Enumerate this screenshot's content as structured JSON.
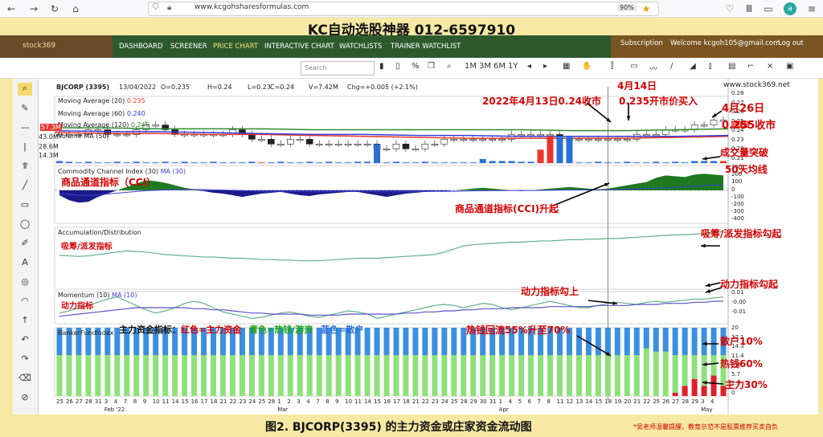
{
  "browser": {
    "url": "www.kcgohsharesformulas.com",
    "zoom": "90%"
  },
  "banner": {
    "title": "KC自动选股神器 012-6597910"
  },
  "site": {
    "logo": "stock369",
    "nav": [
      "DASHBOARD",
      "SCREENER",
      "PRICE CHART",
      "INTERACTIVE CHART",
      "WATCHLISTS",
      "TRAINER WATCHLIST"
    ],
    "subscription": "Subscription",
    "welcome": "Welcome kcgoh105@gmail.com",
    "logout": "Log out"
  },
  "toolbar": {
    "search_placeholder": "Search",
    "periods": [
      "1M",
      "3M",
      "6M",
      "1Y"
    ],
    "watermark": "www.stock369.net"
  },
  "chart_header": {
    "symbol": "BJCORP (3395)",
    "date": "13/04/2022",
    "open": "O=0.235",
    "high": "H=0.24",
    "low": "L=0.23",
    "close": "C=0.24",
    "volume": "V=7.42M",
    "change": "Chg=+0.005 (+2.1%)"
  },
  "legends": {
    "ma20": "Moving Average (20)",
    "ma20_val": "0.235",
    "ma60": "Moving Average (60)",
    "ma60_val": "0.240",
    "ma120": "Moving Average (120)",
    "ma120_val": "0.246",
    "vol": "Volume MA (50)",
    "cci": "Commodity Channel Index (30)",
    "cci_ma": "MA (30)",
    "ad": "Accumulation/Distribution",
    "mom": "Momentum (10)",
    "mom_ma": "MA (10)",
    "bfi": "BankerFundIndex"
  },
  "vol_levels": [
    "57.3M",
    "43.0M",
    "28.6M",
    "14.3M"
  ],
  "price_axis": [
    "0.28",
    "0.27",
    "0.26",
    "0.25",
    "0.24",
    "0.23",
    "0.22",
    "0.21"
  ],
  "price_current": "0.236",
  "cci_axis": [
    "300",
    "200",
    "100",
    "0",
    "-100",
    "-200",
    "-300",
    "-400"
  ],
  "mom_axis": [
    "0.01",
    "-0.00",
    "-0.01"
  ],
  "bfi_axis": [
    "20",
    "17.1",
    "14.3",
    "11.4",
    "8.6",
    "5.7",
    "2.9",
    "0"
  ],
  "date_labels": [
    "25",
    "26",
    "27",
    "28",
    "31",
    "3",
    "4",
    "7",
    "8",
    "9",
    "10",
    "11",
    "14",
    "15",
    "16",
    "17",
    "18",
    "21",
    "22",
    "23",
    "24",
    "25",
    "28",
    "1",
    "2",
    "3",
    "4",
    "7",
    "8",
    "9",
    "10",
    "11",
    "14",
    "15",
    "16",
    "17",
    "18",
    "21",
    "22",
    "23",
    "24",
    "25",
    "28",
    "29",
    "30",
    "31",
    "1",
    "4",
    "5",
    "6",
    "7",
    "8",
    "11",
    "12",
    "13",
    "14",
    "15",
    "18",
    "19",
    "20",
    "21",
    "22",
    "25",
    "26",
    "27",
    "28",
    "29",
    "3",
    "4"
  ],
  "month_labels": {
    "feb": "Feb '22",
    "mar": "Mar",
    "apr": "Apr",
    "may": "May"
  },
  "annotations": {
    "a1": "2022年4月13日0.24收市",
    "a2": "4月14日",
    "a3": "0.235开市价买入",
    "a4": "4月26日",
    "a5": "0.255收市",
    "a6": "成交量突破",
    "a7": "50天均线",
    "a8": "商品通道指标（CCI）",
    "a9": "商品通道指标(CCI)升起",
    "a10": "吸筹/派发指标",
    "a11": "吸筹/派发指标勾起",
    "a12": "动力指标",
    "a13": "动力指标勾上",
    "a14": "动力指标勾起",
    "a15": "主力资金指标：",
    "a15r": "红色=主力资金",
    "a15g": "青色=热钱/游资",
    "a15b": "蓝色=散户",
    "a16": "热钱回流55%升至70%",
    "a17": "散户10%",
    "a18": "热钱60%",
    "a19": "主力30%"
  },
  "footer": {
    "title": "图2. BJCORP(3395) 的主力资金或庄家资金流动图",
    "note": "*吴老师温馨提醒，教育示范不是股票推荐买卖自负"
  },
  "chart_data": {
    "type": "line",
    "ma_series": [
      {
        "name": "Moving Average (20)",
        "color": "#e8362c"
      },
      {
        "name": "Moving Average (60)",
        "color": "#3a3ad8"
      },
      {
        "name": "Moving Average (120)",
        "color": "#2e8b2e"
      }
    ],
    "price_ylim": [
      0.21,
      0.28
    ],
    "price_ma_values": {
      "ma20": [
        0.242,
        0.241,
        0.241,
        0.24,
        0.24,
        0.239,
        0.238,
        0.237,
        0.236,
        0.236,
        0.236,
        0.236,
        0.237,
        0.238
      ],
      "ma60": [
        0.244,
        0.243,
        0.243,
        0.242,
        0.241,
        0.24,
        0.24,
        0.239,
        0.239,
        0.238,
        0.238,
        0.238,
        0.238,
        0.239
      ],
      "ma120": [
        0.247,
        0.247,
        0.246,
        0.246,
        0.246,
        0.245,
        0.245,
        0.245,
        0.245,
        0.245,
        0.244,
        0.244,
        0.245,
        0.246
      ]
    },
    "closes": [
      0.24,
      0.24,
      0.24,
      0.245,
      0.245,
      0.24,
      0.24,
      0.24,
      0.245,
      0.25,
      0.25,
      0.245,
      0.24,
      0.24,
      0.24,
      0.24,
      0.24,
      0.24,
      0.245,
      0.24,
      0.235,
      0.235,
      0.23,
      0.23,
      0.235,
      0.235,
      0.23,
      0.23,
      0.23,
      0.23,
      0.23,
      0.23,
      0.23,
      0.225,
      0.225,
      0.23,
      0.225,
      0.225,
      0.23,
      0.23,
      0.235,
      0.235,
      0.235,
      0.235,
      0.235,
      0.235,
      0.235,
      0.24,
      0.24,
      0.24,
      0.24,
      0.24,
      0.235,
      0.235,
      0.235,
      0.235,
      0.235,
      0.235,
      0.235,
      0.235,
      0.24,
      0.24,
      0.24,
      0.245,
      0.245,
      0.245,
      0.25,
      0.25,
      0.255,
      0.255
    ],
    "volume_M": [
      3,
      2,
      1,
      2,
      1,
      1,
      2,
      1,
      2,
      1,
      1,
      2,
      1,
      2,
      1,
      1,
      2,
      1,
      1,
      1,
      2,
      1,
      1,
      2,
      1,
      1,
      2,
      1,
      2,
      1,
      1,
      2,
      2,
      28,
      1,
      2,
      1,
      1,
      2,
      1,
      1,
      1,
      1,
      1,
      6,
      3,
      3,
      3,
      2,
      2,
      20,
      40,
      40,
      40,
      1,
      1,
      2,
      1,
      1,
      2,
      1,
      1,
      2,
      1,
      2,
      1,
      3,
      3,
      3,
      3
    ],
    "cci_ylim": [
      -400,
      300
    ],
    "cci_values": [
      -60,
      -120,
      -150,
      -140,
      -80,
      -40,
      0,
      40,
      80,
      120,
      110,
      90,
      60,
      30,
      10,
      -10,
      -30,
      -40,
      -60,
      -80,
      -60,
      -40,
      -30,
      -20,
      -40,
      -60,
      -70,
      -50,
      -40,
      -30,
      -20,
      -20,
      -40,
      -60,
      -80,
      -60,
      -40,
      -30,
      -20,
      -10,
      -10,
      0,
      10,
      20,
      30,
      20,
      10,
      0,
      -10,
      0,
      10,
      20,
      30,
      40,
      30,
      20,
      10,
      20,
      40,
      60,
      80,
      100,
      150,
      180,
      170,
      160,
      190,
      200,
      190,
      180
    ],
    "cci_ma_values": [
      -40,
      -50,
      -60,
      -62,
      -55,
      -45,
      -35,
      -25,
      -15,
      -5,
      0,
      5,
      8,
      10,
      10,
      8,
      5,
      2,
      0,
      -5,
      -8,
      -10,
      -12,
      -14,
      -15,
      -16,
      -17,
      -17,
      -16,
      -15,
      -14,
      -13,
      -14,
      -16,
      -18,
      -18,
      -17,
      -16,
      -15,
      -14,
      -13,
      -12,
      -10,
      -8,
      -6,
      -5,
      -4,
      -3,
      -3,
      -2,
      -1,
      0,
      2,
      4,
      5,
      6,
      7,
      8,
      10,
      13,
      16,
      20,
      26,
      32,
      38,
      44,
      50,
      56,
      62,
      66
    ],
    "ad_values": [
      0.55,
      0.54,
      0.53,
      0.54,
      0.56,
      0.58,
      0.6,
      0.62,
      0.61,
      0.6,
      0.58,
      0.56,
      0.55,
      0.54,
      0.53,
      0.52,
      0.52,
      0.51,
      0.5,
      0.5,
      0.49,
      0.48,
      0.48,
      0.47,
      0.47,
      0.46,
      0.46,
      0.46,
      0.47,
      0.48,
      0.49,
      0.5,
      0.5,
      0.5,
      0.51,
      0.52,
      0.53,
      0.54,
      0.55,
      0.56,
      0.6,
      0.65,
      0.7,
      0.72,
      0.73,
      0.74,
      0.75,
      0.76,
      0.76,
      0.77,
      0.78,
      0.78,
      0.79,
      0.8,
      0.8,
      0.81,
      0.81,
      0.82,
      0.82,
      0.83,
      0.84,
      0.85,
      0.86,
      0.87,
      0.88,
      0.88,
      0.89,
      0.9,
      0.92,
      0.93
    ],
    "mom_ylim": [
      -0.015,
      0.015
    ],
    "mom_values": [
      -0.005,
      -0.003,
      0.0,
      0.002,
      0.005,
      0.008,
      0.01,
      0.006,
      0.002,
      -0.002,
      -0.005,
      -0.003,
      0.0,
      0.004,
      0.006,
      0.004,
      0.0,
      -0.004,
      -0.006,
      -0.008,
      -0.01,
      -0.009,
      -0.007,
      -0.005,
      -0.004,
      -0.006,
      -0.008,
      -0.009,
      -0.007,
      -0.005,
      -0.003,
      -0.004,
      -0.006,
      -0.01,
      -0.008,
      -0.006,
      -0.004,
      -0.002,
      0.0,
      0.002,
      0.003,
      0.002,
      0.0,
      0.002,
      0.004,
      0.003,
      0.0,
      -0.002,
      0.0,
      0.002,
      0.004,
      0.006,
      0.004,
      0.002,
      0.0,
      0.0,
      0.002,
      0.004,
      0.005,
      0.004,
      0.003,
      0.005,
      0.006,
      0.005,
      0.006,
      0.007,
      0.008,
      0.008,
      0.009,
      0.01
    ],
    "mom_ma_values": [
      -0.008,
      -0.007,
      -0.006,
      -0.005,
      -0.004,
      -0.003,
      -0.002,
      -0.001,
      0.0,
      0.0,
      0.0,
      0.0,
      0.0,
      0.0,
      -0.001,
      -0.001,
      -0.002,
      -0.002,
      -0.003,
      -0.004,
      -0.005,
      -0.005,
      -0.006,
      -0.006,
      -0.006,
      -0.006,
      -0.007,
      -0.007,
      -0.007,
      -0.007,
      -0.006,
      -0.006,
      -0.006,
      -0.006,
      -0.006,
      -0.006,
      -0.005,
      -0.005,
      -0.004,
      -0.004,
      -0.003,
      -0.003,
      -0.002,
      -0.002,
      -0.001,
      -0.001,
      -0.001,
      0.0,
      0.0,
      0.0,
      0.0,
      0.001,
      0.001,
      0.001,
      0.001,
      0.001,
      0.002,
      0.002,
      0.002,
      0.002,
      0.003,
      0.003,
      0.003,
      0.004,
      0.004,
      0.004,
      0.005,
      0.005,
      0.006,
      0.006
    ],
    "bfi_ylim": [
      0,
      20
    ],
    "bfi_bars": {
      "blue": [
        8,
        8,
        8,
        8,
        8,
        8,
        8,
        8,
        8,
        8,
        8,
        8,
        8,
        8,
        8,
        8,
        8,
        8,
        8,
        8,
        8,
        8,
        8,
        8,
        8,
        8,
        8,
        8,
        8,
        8,
        8,
        8,
        8,
        8,
        8,
        8,
        8,
        8,
        8,
        8,
        8,
        8,
        8,
        8,
        8,
        8,
        8,
        8,
        8,
        8,
        8,
        8,
        8,
        8,
        8,
        8,
        8,
        8,
        8,
        8,
        8,
        6,
        5,
        5,
        4,
        4,
        3,
        2,
        2,
        2
      ],
      "green": [
        12,
        12,
        12,
        12,
        12,
        12,
        12,
        12,
        12,
        12,
        12,
        12,
        12,
        12,
        12,
        12,
        12,
        12,
        12,
        12,
        12,
        12,
        12,
        12,
        12,
        12,
        12,
        12,
        12,
        12,
        12,
        12,
        12,
        12,
        12,
        12,
        12,
        12,
        12,
        12,
        12,
        12,
        12,
        12,
        12,
        12,
        12,
        12,
        12,
        12,
        12,
        12,
        12,
        12,
        12,
        12,
        12,
        12,
        12,
        12,
        12,
        14,
        13,
        13,
        12,
        12,
        12,
        12,
        12,
        12
      ],
      "red": [
        0,
        0,
        0,
        0,
        0,
        0,
        0,
        0,
        0,
        0,
        0,
        0,
        0,
        0,
        0,
        0,
        0,
        0,
        0,
        0,
        0,
        0,
        0,
        0,
        0,
        0,
        0,
        0,
        0,
        0,
        0,
        0,
        0,
        0,
        0,
        0,
        0,
        0,
        0,
        0,
        0,
        0,
        0,
        0,
        0,
        0,
        0,
        0,
        0,
        0,
        0,
        0,
        0,
        0,
        0,
        0,
        0,
        0,
        0,
        0,
        0,
        0,
        0,
        0,
        1,
        3,
        5,
        3,
        6,
        3
      ]
    }
  }
}
